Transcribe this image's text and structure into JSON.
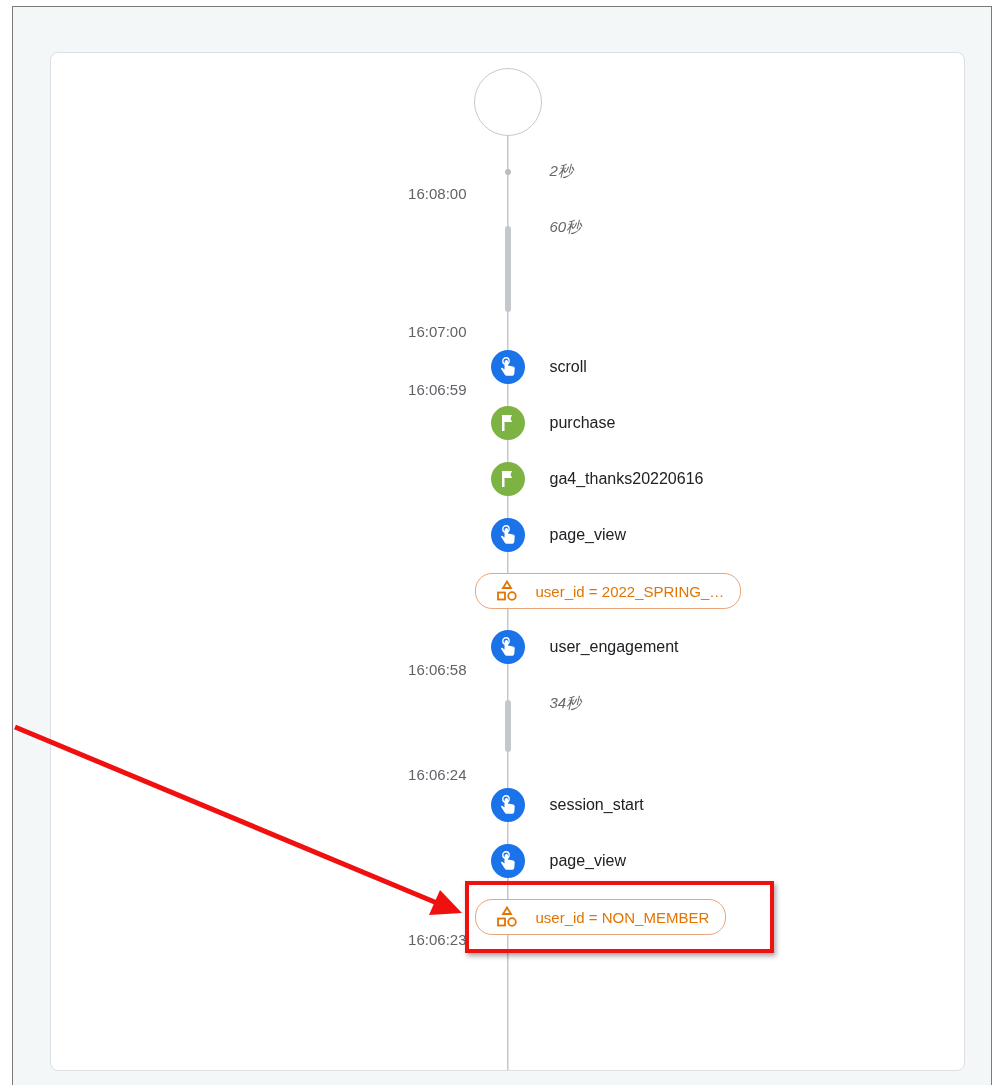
{
  "timeline": [
    {
      "kind": "start"
    },
    {
      "kind": "pause",
      "duration": "2秒",
      "time": "16:08:00"
    },
    {
      "kind": "long_pause",
      "duration": "60秒",
      "time": "16:07:00"
    },
    {
      "kind": "click_event",
      "name": "scroll",
      "time": "16:06:59"
    },
    {
      "kind": "conversion_event",
      "name": "purchase"
    },
    {
      "kind": "conversion_event",
      "name": "ga4_thanks20220616"
    },
    {
      "kind": "click_event",
      "name": "page_view"
    },
    {
      "kind": "property",
      "label": "user_id = 2022_SPRING_…",
      "highlighted": false
    },
    {
      "kind": "click_event",
      "name": "user_engagement",
      "time": "16:06:58"
    },
    {
      "kind": "long_pause",
      "duration": "34秒",
      "time": "16:06:24"
    },
    {
      "kind": "click_event",
      "name": "session_start"
    },
    {
      "kind": "click_event",
      "name": "page_view"
    },
    {
      "kind": "property",
      "label": "user_id = NON_MEMBER",
      "time": "16:06:23",
      "highlighted": true
    }
  ]
}
